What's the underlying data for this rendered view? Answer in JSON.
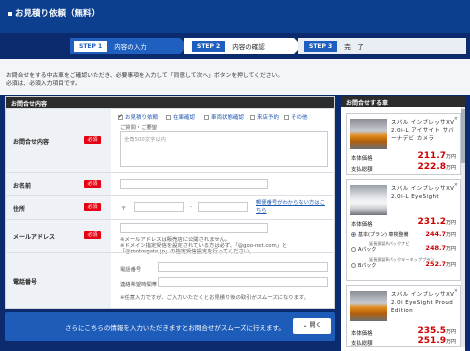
{
  "header": {
    "title": "お見積り依頼（無料）"
  },
  "steps": [
    {
      "num": "STEP 1",
      "label": "内容の入力"
    },
    {
      "num": "STEP 2",
      "label": "内容の確認"
    },
    {
      "num": "STEP 3",
      "label": "完　了"
    }
  ],
  "intro": {
    "line1": "お問合せをする中古車をご確認いただき、必要事項を入力して「同意して次へ」ボタンを押してください。",
    "line2": "必須は、必須入力項目です。"
  },
  "form": {
    "heading": "お問合せ内容",
    "required_badge": "必須",
    "inquiry": {
      "label": "お問合せ内容",
      "options": [
        {
          "label": "お見積り依頼",
          "checked": true
        },
        {
          "label": "在庫確認",
          "checked": false
        },
        {
          "label": "車両状態確認",
          "checked": false
        },
        {
          "label": "来店予約",
          "checked": false
        },
        {
          "label": "その他",
          "checked": false
        }
      ],
      "remarks_label": "ご質問・ご要望",
      "remarks_placeholder": "全角500文字以内"
    },
    "name": {
      "label": "お名前"
    },
    "address": {
      "label": "住所",
      "postal_prefix": "〒",
      "postal_sep": "-",
      "zip_link": "郵便番号がわからない方はこちら"
    },
    "email": {
      "label": "メールアドレス",
      "note1": "※メールアドレスは販売店に公開されません。",
      "note2": "※ドメイン指定受信を設定されている方は必ず、「@goo-net.com」と",
      "note3": "「@motorgate.jp」の指定受信設定を行ってください。"
    },
    "phone": {
      "label": "電話番号",
      "tel_label": "電話番号",
      "contact_time_label": "連絡希望時間帯",
      "note": "※任意入力ですが、ご入力いただくとお見積り後の取引がスムーズになります。"
    }
  },
  "cta": {
    "text": "さらにこちらの情報を入力いただきますとお問合せがスムーズに行えます。",
    "button": "開く"
  },
  "sidebar": {
    "heading": "お問合せする車",
    "close_label": "×",
    "price_label": "本体価格",
    "total_label": "支払総額",
    "unit": "万円",
    "cars": [
      {
        "name": "スバル インプレッサXV 2.0i-L アイサイト サバーナデビ カメラ",
        "price": "211.7",
        "total": "222.8"
      },
      {
        "name": "スバル インプレッサXV 2.0i-L EyeSight",
        "price": "231.2",
        "options": [
          {
            "label": "基本(プラン)",
            "detail": "車検整備",
            "value": "244.7",
            "selected": true
          },
          {
            "label": "Aパック",
            "detail": "延長保証Aパックナビ",
            "value": "248.7",
            "selected": false
          },
          {
            "label": "Bパック",
            "detail": "延長保証Bパックキーネッププラン",
            "value": "252.7",
            "selected": false
          }
        ]
      },
      {
        "name": "スバル インプレッサXV 2.0i EyeSight Proud Edition",
        "price": "235.5",
        "total": "251.9"
      }
    ]
  }
}
